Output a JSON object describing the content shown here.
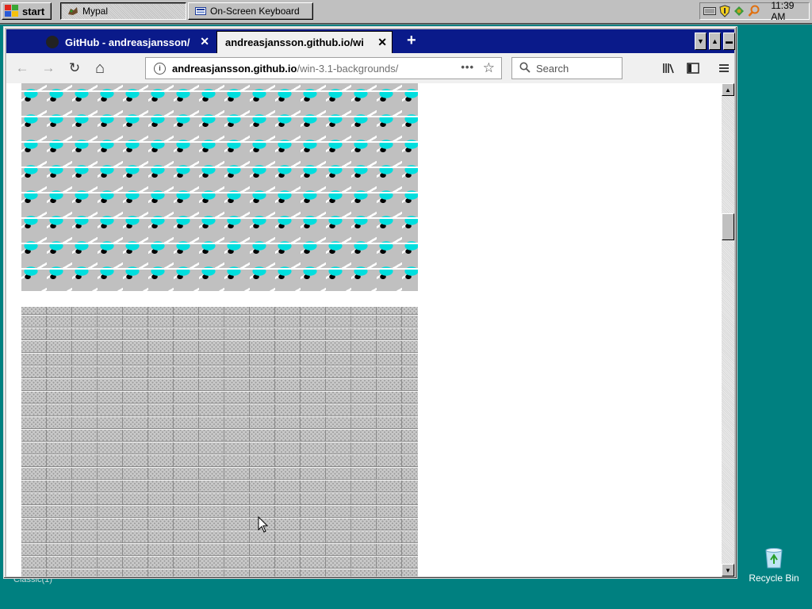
{
  "taskbar": {
    "start_label": "start",
    "tasks": [
      {
        "label": "Mypal",
        "icon": "mypal-icon"
      },
      {
        "label": "On-Screen Keyboard",
        "icon": "keyboard-icon"
      }
    ],
    "tray": {
      "icons": [
        "keyboard-layout-icon",
        "shield-icon",
        "network-icon",
        "search-tray-icon"
      ],
      "clock": "11:39 AM"
    }
  },
  "desktop": {
    "recycle_bin_label": "Recycle Bin",
    "background_label": "Classic(1)",
    "background_color": "#008080"
  },
  "browser": {
    "tabs": [
      {
        "title": "GitHub - andreasjansson/",
        "active": false,
        "close": "✕"
      },
      {
        "title": "andreasjansson.github.io/wi",
        "active": true,
        "close": "✕"
      }
    ],
    "new_tab": "+",
    "nav": {
      "back": "←",
      "forward": "→",
      "reload": "↻",
      "home": "⌂"
    },
    "url": {
      "host": "andreasjansson.github.io",
      "path": "/win-3.1-backgrounds/",
      "more": "•••",
      "star": "☆"
    },
    "search": {
      "placeholder": "Search"
    },
    "toolbar": {
      "library": "|||\\",
      "sidebar": "▣",
      "menu": "☰"
    },
    "tabstrip_color": "#0a1a8a"
  },
  "page": {
    "patterns": [
      "cars-pattern",
      "bricks-pattern"
    ]
  },
  "scrollbar": {
    "position": 0.28
  }
}
